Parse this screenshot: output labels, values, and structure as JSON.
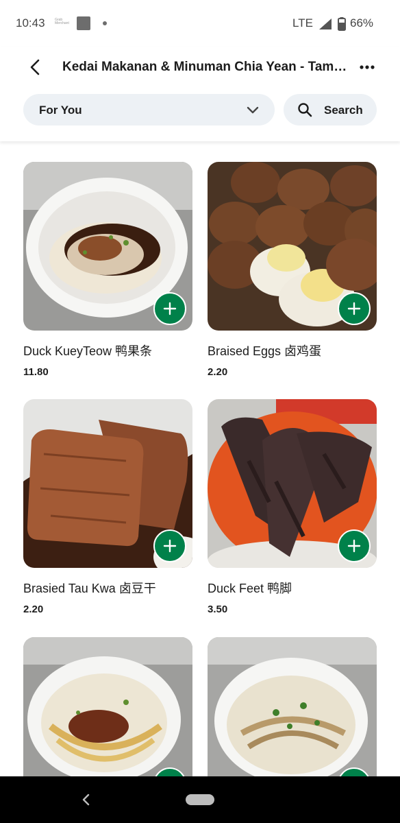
{
  "status_bar": {
    "time": "10:43",
    "carrier_text": "GrabMerchant",
    "network": "LTE",
    "battery": "66%"
  },
  "header": {
    "title": "Kedai Makanan & Minuman Chia Yean - Tam…",
    "category_selected": "For You",
    "search_label": "Search"
  },
  "menu": {
    "items": [
      {
        "name": "Duck KueyTeow 鸭果条",
        "price": "11.80"
      },
      {
        "name": "Braised Eggs 卤鸡蛋",
        "price": "2.20"
      },
      {
        "name": "Brasied Tau Kwa 卤豆干",
        "price": "2.20"
      },
      {
        "name": "Duck Feet 鸭脚",
        "price": "3.50"
      },
      {
        "name": "",
        "price": ""
      },
      {
        "name": "",
        "price": ""
      }
    ]
  },
  "colors": {
    "accent_green": "#00814a",
    "pill_bg": "#edf1f5",
    "navbar": "#000000"
  },
  "icons": [
    "back-arrow-icon",
    "more-icon",
    "chevron-down-icon",
    "search-icon",
    "plus-icon",
    "nav-back-icon"
  ]
}
